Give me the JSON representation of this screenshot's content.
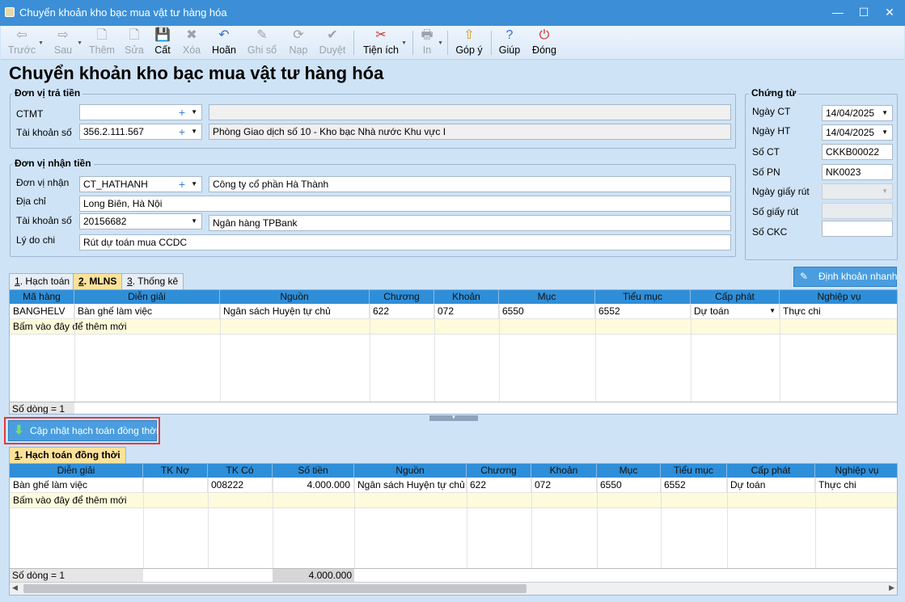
{
  "window": {
    "title": "Chuyển khoản kho bạc mua vật tư hàng hóa",
    "min": "—",
    "max": "☐",
    "close": "✕"
  },
  "toolbar": {
    "prev": "Trước",
    "next": "Sau",
    "add": "Thêm",
    "edit": "Sửa",
    "save": "Cất",
    "delete": "Xóa",
    "undo": "Hoãn",
    "post": "Ghi sổ",
    "load": "Nạp",
    "approve": "Duyệt",
    "utilities": "Tiện ích",
    "print": "In",
    "feedback": "Góp ý",
    "help": "Giúp",
    "close": "Đóng"
  },
  "page_title": "Chuyển khoản kho bạc mua vật tư hàng hóa",
  "payer": {
    "group_title": "Đơn vị trả tiền",
    "ctmt_label": "CTMT",
    "ctmt_value": "",
    "ctmt_desc": "",
    "account_label": "Tài khoản số",
    "account_value": "356.2.111.567",
    "account_desc": "Phòng Giao dịch số 10 - Kho bạc Nhà nước Khu vực I"
  },
  "payee": {
    "group_title": "Đơn vị nhận tiền",
    "unit_label": "Đơn vị nhận",
    "unit_value": "CT_HATHANH",
    "unit_desc": "Công ty cổ phần Hà Thành",
    "address_label": "Địa chỉ",
    "address_value": "Long Biên, Hà Nội",
    "account_label": "Tài khoản số",
    "account_value": "20156682",
    "account_desc": "Ngân hàng TPBank",
    "reason_label": "Lý do chi",
    "reason_value": "Rút dự toán mua CCDC"
  },
  "voucher": {
    "group_title": "Chứng từ",
    "ngay_ct_label": "Ngày CT",
    "ngay_ct": "14/04/2025",
    "ngay_ht_label": "Ngày HT",
    "ngay_ht": "14/04/2025",
    "so_ct_label": "Số CT",
    "so_ct": "CKKB00022",
    "so_pn_label": "Số PN",
    "so_pn": "NK0023",
    "ngay_giay_rut_label": "Ngày giấy rút",
    "ngay_giay_rut": "",
    "so_giay_rut_label": "Số giấy rút",
    "so_giay_rut": "",
    "so_ckc_label": "Số CKC",
    "so_ckc": ""
  },
  "tabs_top": [
    {
      "num": "1",
      "label": ". Hạch toán"
    },
    {
      "num": "2",
      "label": ". MLNS"
    },
    {
      "num": "3",
      "label": ". Thống kê"
    }
  ],
  "quick_entry_button": "Định khoản nhanh",
  "grid1": {
    "headers": [
      "Mã hàng",
      "Diễn giải",
      "Nguồn",
      "Chương",
      "Khoản",
      "Mục",
      "Tiểu mục",
      "Cấp phát",
      "Nghiệp vụ"
    ],
    "row": [
      "BANGHELV",
      "Bàn ghế làm việc",
      "Ngân sách Huyện tự chủ",
      "622",
      "072",
      "6550",
      "6552",
      "Dự toán",
      "Thực chi"
    ],
    "add_row": "Bấm vào đây để thêm mới",
    "footer": "Số dòng = 1"
  },
  "update_button": "Cập nhật hạch toán đồng thời",
  "tab_bottom": {
    "num": "1",
    "label": ". Hạch toán đồng thời"
  },
  "grid2": {
    "headers": [
      "Diễn giải",
      "TK Nợ",
      "TK Có",
      "Số tiền",
      "Nguồn",
      "Chương",
      "Khoản",
      "Mục",
      "Tiểu mục",
      "Cấp phát",
      "Nghiệp vụ"
    ],
    "row": [
      "Bàn ghế làm việc",
      "",
      "008222",
      "4.000.000",
      "Ngân sách Huyện tự chủ",
      "622",
      "072",
      "6550",
      "6552",
      "Dự toán",
      "Thực chi"
    ],
    "add_row": "Bấm vào đây để thêm mới",
    "footer": "Số dòng = 1",
    "footer_total": "4.000.000"
  },
  "colors": {
    "title_bar": "#3c8fd6",
    "grid_header": "#2f8ed8",
    "active_tab": "#fbe29a",
    "highlight_border": "#e23b3b"
  },
  "icons": [
    "arrow-left-icon",
    "arrow-right-icon",
    "new-doc-icon",
    "edit-doc-icon",
    "save-icon",
    "delete-icon",
    "undo-icon",
    "pencil-icon",
    "refresh-icon",
    "check-icon",
    "tools-icon",
    "printer-icon",
    "upload-icon",
    "help-icon",
    "power-icon"
  ]
}
